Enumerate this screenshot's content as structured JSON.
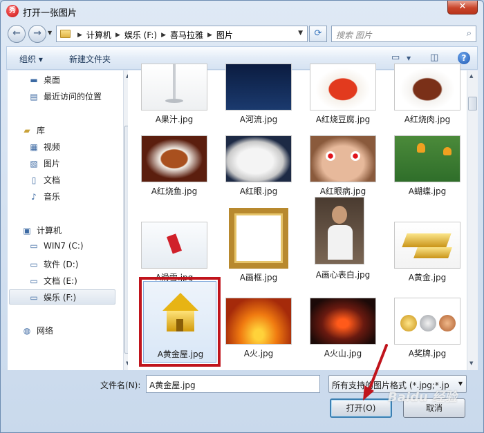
{
  "window": {
    "title": "打开一张图片",
    "app_icon_glyph": "秀",
    "close_glyph": "✕"
  },
  "address_bar": {
    "back_glyph": "←",
    "forward_glyph": "→",
    "crumbs": [
      "计算机",
      "娱乐 (F:)",
      "喜马拉雅",
      "图片"
    ],
    "refresh_glyph": "⟳",
    "search_placeholder": "搜索 图片"
  },
  "toolbar": {
    "organize_label": "组织 ▾",
    "new_folder_label": "新建文件夹",
    "view_icon": "view-icon",
    "preview_icon": "preview-pane-icon",
    "help_glyph": "?"
  },
  "sidebar": {
    "items": [
      {
        "label": "桌面",
        "icon": "desktop-icon",
        "glyph": "▬"
      },
      {
        "label": "最近访问的位置",
        "icon": "recent-icon",
        "glyph": "▤"
      },
      {
        "label": "库",
        "icon": "library-icon",
        "glyph": "▰"
      },
      {
        "label": "视频",
        "icon": "video-icon",
        "glyph": "▦"
      },
      {
        "label": "图片",
        "icon": "picture-icon",
        "glyph": "▧"
      },
      {
        "label": "文档",
        "icon": "document-icon",
        "glyph": "▯"
      },
      {
        "label": "音乐",
        "icon": "music-icon",
        "glyph": "♪"
      },
      {
        "label": "计算机",
        "icon": "computer-icon",
        "glyph": "▣"
      },
      {
        "label": "WIN7 (C:)",
        "icon": "drive-c-icon",
        "glyph": "▭"
      },
      {
        "label": "软件 (D:)",
        "icon": "drive-d-icon",
        "glyph": "▭"
      },
      {
        "label": "文档 (E:)",
        "icon": "drive-e-icon",
        "glyph": "▭"
      },
      {
        "label": "娱乐 (F:)",
        "icon": "drive-f-icon",
        "glyph": "▭"
      },
      {
        "label": "网络",
        "icon": "network-icon",
        "glyph": "◍"
      }
    ]
  },
  "files": [
    {
      "name": "A果汁.jpg"
    },
    {
      "name": "A河流.jpg"
    },
    {
      "name": "A红烧豆腐.jpg"
    },
    {
      "name": "A红烧肉.jpg"
    },
    {
      "name": "A红烧鱼.jpg"
    },
    {
      "name": "A红眼.jpg"
    },
    {
      "name": "A红眼病.jpg"
    },
    {
      "name": "A蝴蝶.jpg"
    },
    {
      "name": "A滑雪.jpg"
    },
    {
      "name": "A画框.jpg"
    },
    {
      "name": "A画心表白.jpg"
    },
    {
      "name": "A黄金.jpg"
    },
    {
      "name": "A黄金屋.jpg"
    },
    {
      "name": "A火.jpg"
    },
    {
      "name": "A火山.jpg"
    },
    {
      "name": "A奖牌.jpg"
    }
  ],
  "footer": {
    "filename_label": "文件名(N):",
    "filename_value": "A黄金屋.jpg",
    "filetype_value": "所有支持的图片格式 (*.jpg;*.jp",
    "open_label": "打开(O)",
    "cancel_label": "取消"
  },
  "watermark": "Baidu 经验"
}
